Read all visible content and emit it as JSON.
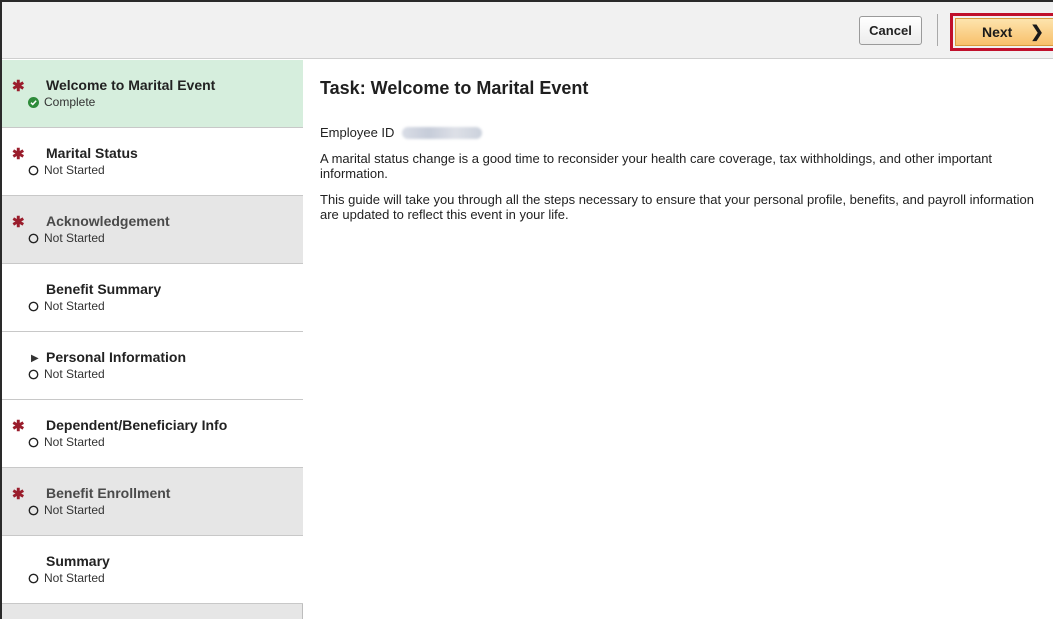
{
  "toolbar": {
    "cancel_label": "Cancel",
    "next_label": "Next",
    "next_chevron": "❯"
  },
  "steps": [
    {
      "label": "Welcome to Marital Event",
      "status": "Complete",
      "required": true,
      "state": "complete"
    },
    {
      "label": "Marital Status",
      "status": "Not Started",
      "required": true,
      "state": "not-started"
    },
    {
      "label": "Acknowledgement",
      "status": "Not Started",
      "required": true,
      "state": "not-started"
    },
    {
      "label": "Benefit Summary",
      "status": "Not Started",
      "required": false,
      "state": "not-started"
    },
    {
      "label": "Personal Information",
      "status": "Not Started",
      "required": false,
      "state": "not-started",
      "expandable": true
    },
    {
      "label": "Dependent/Beneficiary Info",
      "status": "Not Started",
      "required": true,
      "state": "not-started"
    },
    {
      "label": "Benefit Enrollment",
      "status": "Not Started",
      "required": true,
      "state": "not-started"
    },
    {
      "label": "Summary",
      "status": "Not Started",
      "required": false,
      "state": "not-started"
    }
  ],
  "icons": {
    "required": "required-asterisk-icon",
    "complete": "check-circle-icon",
    "not_started": "empty-circle-icon",
    "expand": "caret-right-icon"
  },
  "main": {
    "title": "Task: Welcome to Marital Event",
    "employee_id_label": "Employee ID",
    "paragraph_1": "A marital status change is a good time to reconsider your health care coverage, tax withholdings, and other important information.",
    "paragraph_2": "This guide will take you through all the steps necessary to ensure that your personal profile, benefits, and payroll information are updated to reflect this event in your life."
  },
  "colors": {
    "active_step_bg": "#d6eedd",
    "required_star": "#9a1d2c",
    "complete_green": "#2e8b3a",
    "next_highlight_border": "#c0102b",
    "next_button_fill": "#f8c06b"
  }
}
